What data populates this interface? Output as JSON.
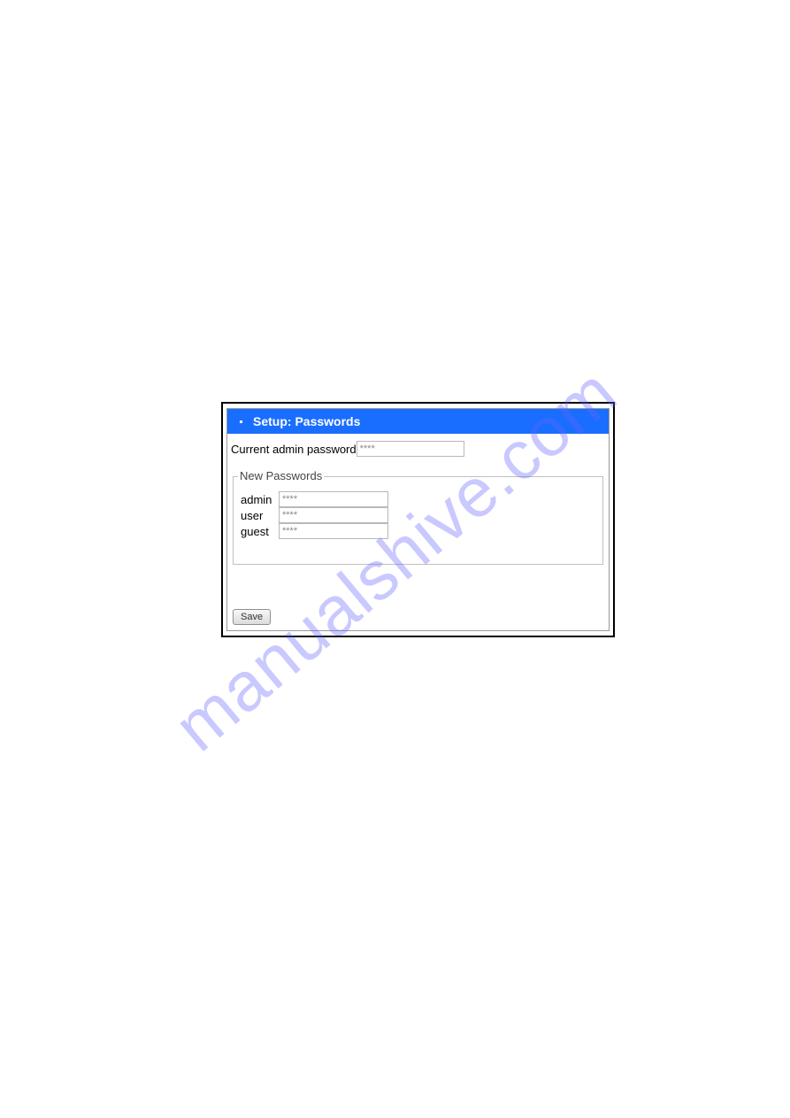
{
  "watermark": "manualshive.com",
  "header": {
    "title": "Setup: Passwords"
  },
  "current": {
    "label": "Current admin password",
    "value": "****"
  },
  "fieldset": {
    "legend": "New Passwords",
    "rows": [
      {
        "label": "admin",
        "value": "****"
      },
      {
        "label": "user",
        "value": "****"
      },
      {
        "label": "guest",
        "value": "****"
      }
    ]
  },
  "buttons": {
    "save": "Save"
  }
}
